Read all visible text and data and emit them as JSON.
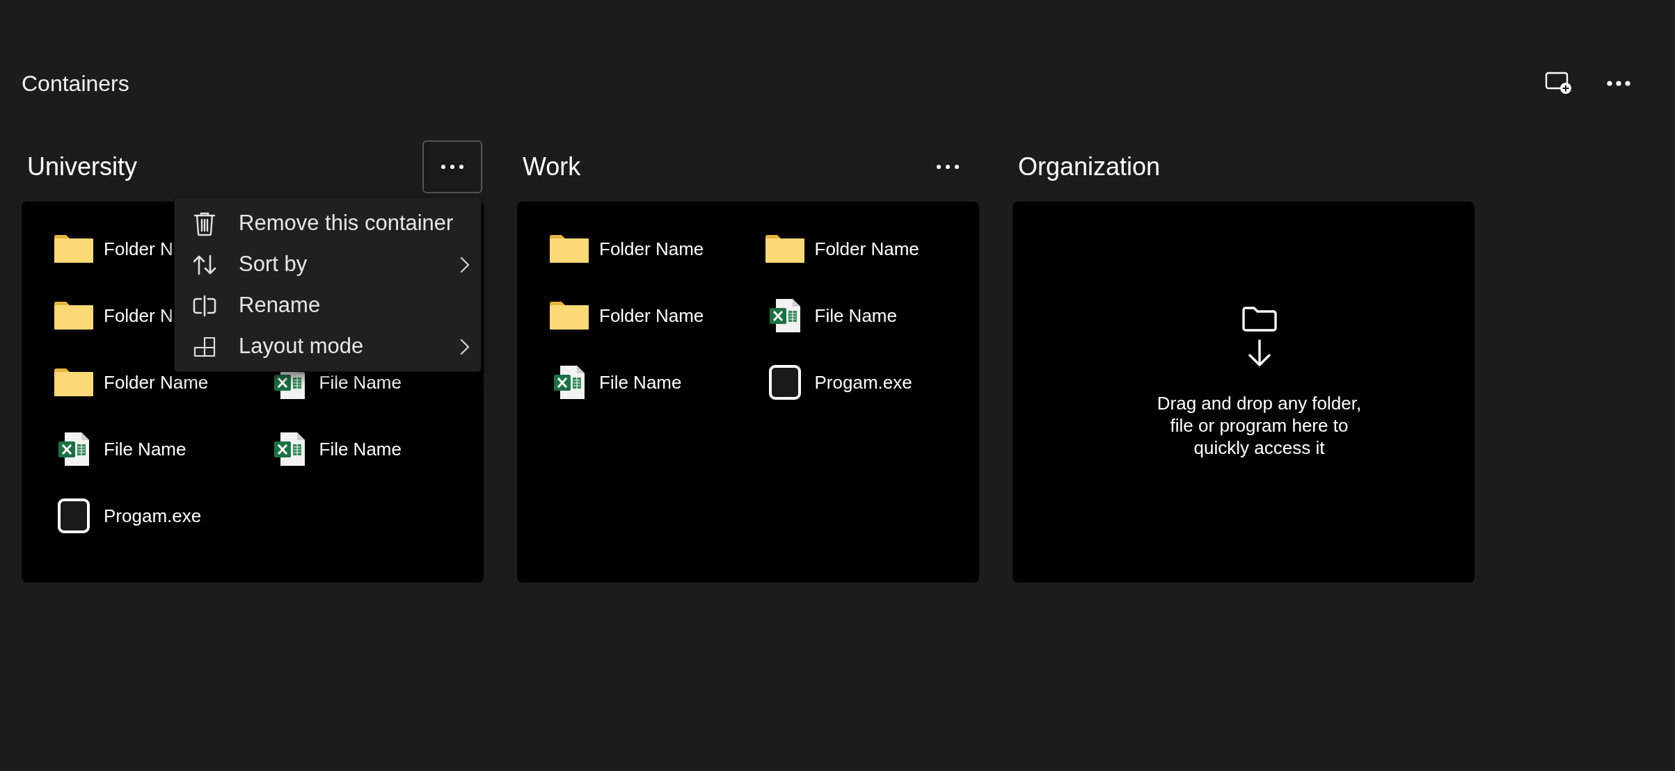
{
  "page": {
    "title": "Containers"
  },
  "containers": [
    {
      "title": "University",
      "more_button": {
        "active": true
      },
      "rows": [
        [
          {
            "kind": "folder",
            "label": "Folder N"
          }
        ],
        [
          {
            "kind": "folder",
            "label": "Folder N"
          }
        ],
        [
          {
            "kind": "folder",
            "label": "Folder Name"
          },
          {
            "kind": "spreadsheet",
            "label": "File Name"
          }
        ],
        [
          {
            "kind": "spreadsheet",
            "label": "File Name"
          },
          {
            "kind": "spreadsheet",
            "label": "File Name"
          }
        ],
        [
          {
            "kind": "program",
            "label": "Progam.exe"
          }
        ]
      ],
      "context_menu": [
        {
          "kind": "trash",
          "label": "Remove this container",
          "submenu": false
        },
        {
          "kind": "sort",
          "label": "Sort by",
          "submenu": true
        },
        {
          "kind": "rename",
          "label": "Rename",
          "submenu": false
        },
        {
          "kind": "layout",
          "label": "Layout mode",
          "submenu": true
        }
      ]
    },
    {
      "title": "Work",
      "more_button": {
        "active": false
      },
      "rows": [
        [
          {
            "kind": "folder",
            "label": "Folder Name"
          },
          {
            "kind": "folder",
            "label": "Folder Name"
          }
        ],
        [
          {
            "kind": "folder",
            "label": "Folder Name"
          },
          {
            "kind": "spreadsheet",
            "label": "File Name"
          }
        ],
        [
          {
            "kind": "spreadsheet",
            "label": "File Name"
          },
          {
            "kind": "program",
            "label": "Progam.exe"
          }
        ]
      ]
    },
    {
      "title": "Organization",
      "empty_hint": "Drag and drop any folder, file or program here to quickly access it"
    }
  ]
}
